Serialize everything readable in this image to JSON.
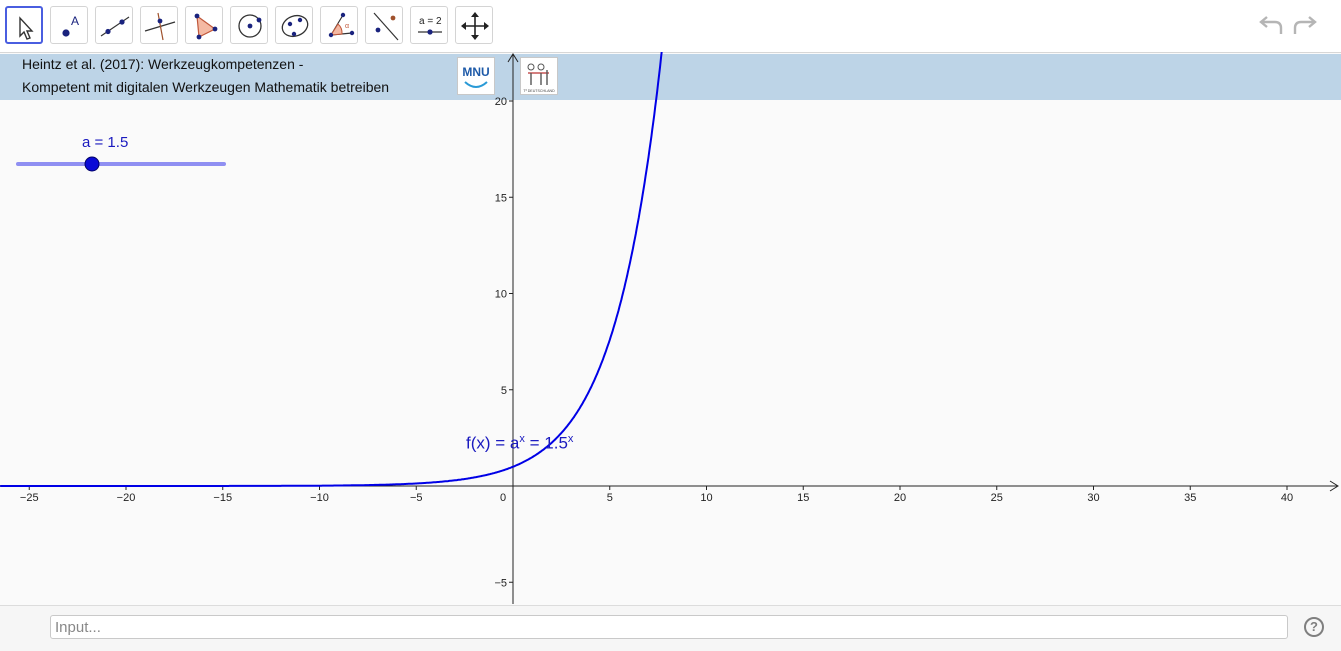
{
  "toolbar": {
    "tools": [
      {
        "name": "move-tool",
        "icon": "cursor-arrow-icon"
      },
      {
        "name": "point-tool",
        "icon": "point-icon"
      },
      {
        "name": "line-tool",
        "icon": "line-through-points-icon"
      },
      {
        "name": "perpendicular-tool",
        "icon": "perpendicular-line-icon"
      },
      {
        "name": "polygon-tool",
        "icon": "polygon-icon"
      },
      {
        "name": "circle-tool",
        "icon": "circle-center-point-icon"
      },
      {
        "name": "conic-tool",
        "icon": "ellipse-icon"
      },
      {
        "name": "angle-tool",
        "icon": "angle-icon"
      },
      {
        "name": "reflect-tool",
        "icon": "reflect-about-line-icon"
      },
      {
        "name": "slider-tool",
        "icon": "slider-icon",
        "label": "a = 2"
      },
      {
        "name": "move-graphics-view-tool",
        "icon": "move-view-arrows-icon"
      }
    ],
    "undo_icon": "undo-icon",
    "redo_icon": "redo-icon"
  },
  "banner": {
    "line1": "Heintz et al. (2017): Werkzeugkompetenzen -",
    "line2": "Kompetent mit digitalen Werkzeugen Mathematik betreiben",
    "logo1_text": "MNU",
    "logo2_text": "T³ DEUTSCHLAND"
  },
  "slider": {
    "label": "a = 1.5",
    "min": -5,
    "max": 5,
    "value": 1.5
  },
  "function": {
    "name": "f(x)",
    "definition": "a",
    "evaluated_base": "1.5",
    "exponent": "x"
  },
  "axes": {
    "x_ticks": [
      "−25",
      "−20",
      "−15",
      "−10",
      "−5",
      "0",
      "5",
      "10",
      "15",
      "20",
      "25",
      "30",
      "35",
      "40"
    ],
    "y_ticks": [
      "−5",
      "5",
      "10",
      "15",
      "20"
    ],
    "x_range": [
      -26.5,
      42.7
    ],
    "y_range": [
      -6.3,
      22.6
    ]
  },
  "colors": {
    "curve": "#0000e6",
    "label": "#1a1abf",
    "slider_track": "#8f8ff2",
    "slider_knob": "#0a0ad6",
    "banner": "#bdd4e7"
  },
  "input": {
    "placeholder": "Input..."
  },
  "help_icon": "help-question-icon"
}
